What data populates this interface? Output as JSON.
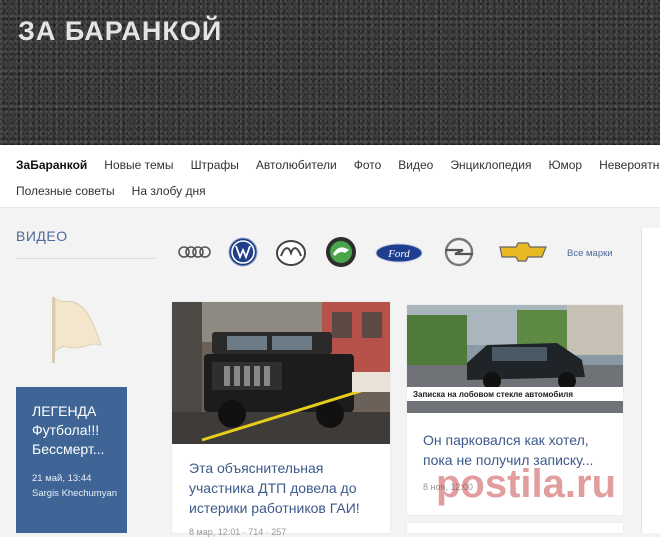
{
  "header": {
    "logo": "ЗА БАРАНКОЙ"
  },
  "nav": {
    "row1": [
      "ЗаБаранкой",
      "Новые темы",
      "Штрафы",
      "Автолюбители",
      "Фото",
      "Видео",
      "Энциклопедия",
      "Юмор",
      "Невероятно"
    ],
    "row2": [
      "Полезные советы",
      "На злобу дня"
    ]
  },
  "sidebar": {
    "title": "ВИДЕО",
    "video": {
      "title": "ЛЕГЕНДА Футбола!!! Бессмерт...",
      "date": "21 май, 13:44",
      "author": "Sargis Khechumyan"
    }
  },
  "brands": {
    "items": [
      "audi-logo",
      "volkswagen-logo",
      "mazda-logo",
      "skoda-logo",
      "ford-logo",
      "opel-logo",
      "chevrolet-logo"
    ],
    "ford_text": "Ford",
    "all_label": "Все марки"
  },
  "articles": [
    {
      "title": "Эта объяснительная участника ДТП довела до истерики работников ГАИ!",
      "meta": "8 мар, 12:01 · 714 · 257"
    },
    {
      "title": "Он парковался как хотел, пока не получил записку...",
      "photo_caption": "Записка на лобовом стекле автомобиля",
      "meta": "8 ноя, 12:00"
    }
  ],
  "watermark": "postila.ru",
  "colors": {
    "accent": "#3f6596",
    "link": "#3c5a8a",
    "header_bg": "#3a3a3a"
  }
}
